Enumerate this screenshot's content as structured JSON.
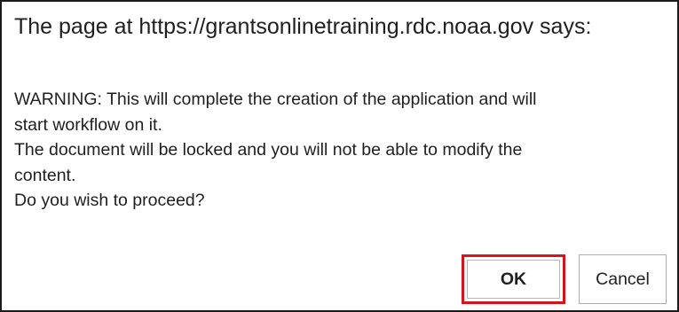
{
  "dialog": {
    "title": "The page at https://grantsonlinetraining.rdc.noaa.gov says:",
    "message_lines": [
      "WARNING: This will complete the creation of the application and will",
      "start workflow on it.",
      "The document will be locked and you will not be able to modify the",
      "content.",
      "Do you wish to proceed?"
    ],
    "ok_label": "OK",
    "cancel_label": "Cancel"
  },
  "colors": {
    "highlight_border": "#d4141c",
    "dialog_border": "#1a1a1a",
    "text": "#1f1f1f"
  }
}
